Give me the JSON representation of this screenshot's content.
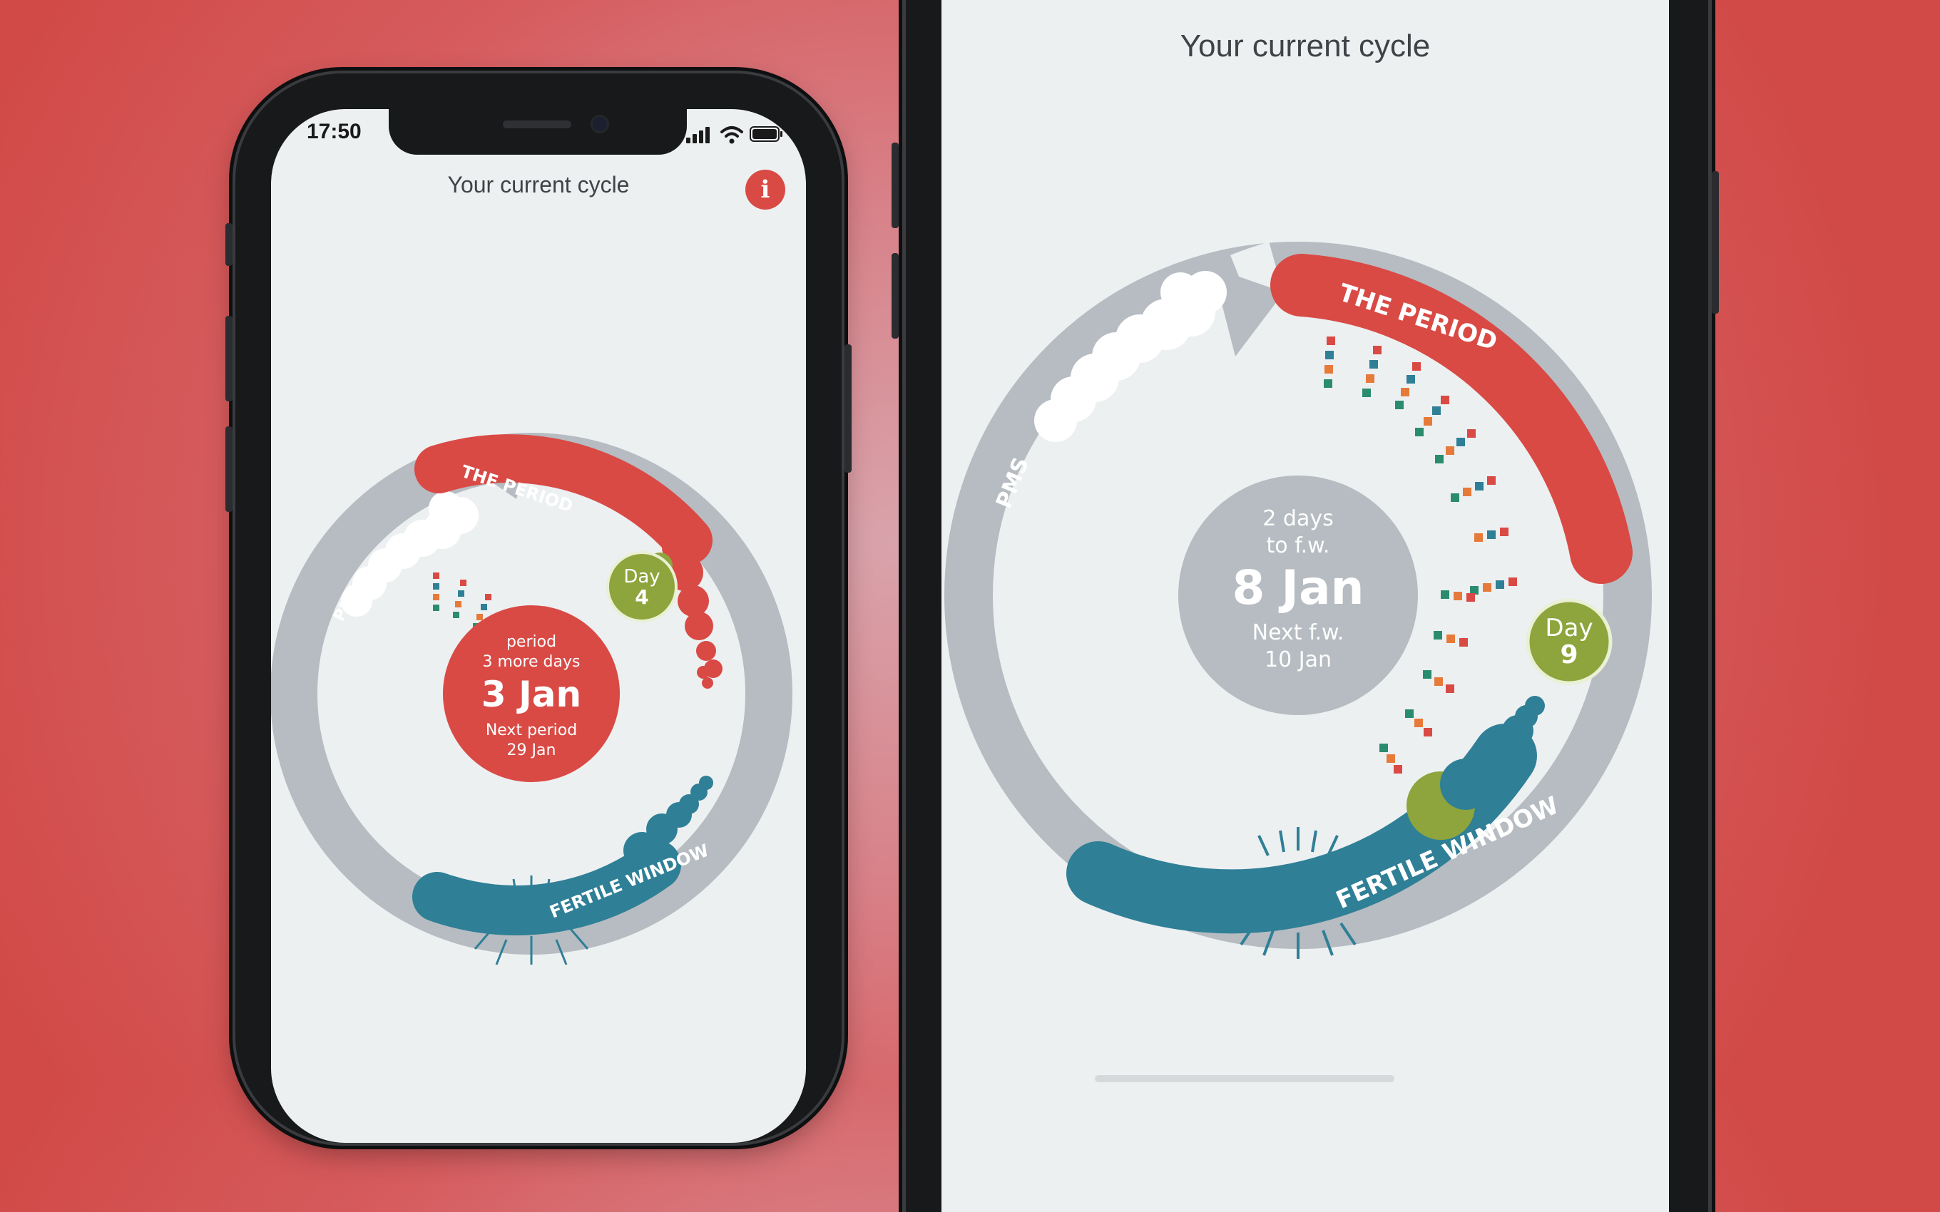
{
  "colors": {
    "period": "#d94a45",
    "fertile": "#2f7f96",
    "day_marker": "#8ea43c",
    "ring": "#b6bcc1",
    "screen": "#edf0f1",
    "pms_cloud": "#ffffff"
  },
  "left_phone": {
    "status_time": "17:50",
    "title": "Your current cycle",
    "info_icon": "i",
    "ring": {
      "period_label": "THE PERIOD",
      "fertile_label": "FERTILE WINDOW",
      "pms_label": "PMS",
      "day_label": "Day",
      "day_number": "4"
    },
    "center": {
      "line1": "period",
      "line2": "3 more days",
      "date": "3 Jan",
      "next_label": "Next period",
      "next_date": "29 Jan"
    }
  },
  "right_phone": {
    "title": "Your current cycle",
    "ring": {
      "period_label": "THE PERIOD",
      "fertile_label": "FERTILE WINDOW",
      "pms_label": "PMS",
      "day_label": "Day",
      "day_number": "9"
    },
    "center": {
      "line1": "2 days",
      "line2": "to f.w.",
      "date": "8 Jan",
      "next_label": "Next f.w.",
      "next_date": "10 Jan"
    }
  }
}
